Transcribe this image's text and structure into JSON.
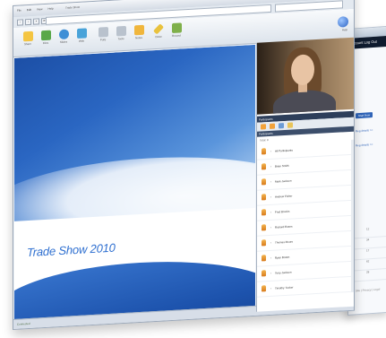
{
  "window": {
    "menu": [
      "File",
      "Edit",
      "View",
      "Help"
    ],
    "title": "Trade Show",
    "controls": [
      "–",
      "□",
      "×"
    ]
  },
  "navbar": {
    "buttons": [
      "‹",
      "›",
      "×",
      "⟳"
    ]
  },
  "toolbar": {
    "items": [
      {
        "label": "Share",
        "icon": "share-icon",
        "color": "#f4c542"
      },
      {
        "label": "Files",
        "icon": "files-icon",
        "color": "#5aa84a"
      },
      {
        "label": "Slides",
        "icon": "slides-icon",
        "color": "#3e8fd6"
      },
      {
        "label": "Web",
        "icon": "web-icon",
        "color": "#49a3d9"
      },
      {
        "label": "Polls",
        "icon": "polls-icon",
        "color": "#b9c2cd"
      },
      {
        "label": "Tools",
        "icon": "tools-icon",
        "color": "#b9c2cd"
      },
      {
        "label": "Notes",
        "icon": "notes-icon",
        "color": "#f0b63c"
      },
      {
        "label": "Draw",
        "icon": "draw-icon",
        "color": "#e9c23d"
      },
      {
        "label": "Record",
        "icon": "record-icon",
        "color": "#7fb04a"
      }
    ],
    "help_label": "Help"
  },
  "slide": {
    "title": "Trade Show 2010"
  },
  "status": {
    "text": "Connected"
  },
  "participants": {
    "header": "Participants",
    "subheader": "Participants",
    "filter": "Total: 9",
    "icons": [
      "person-icon",
      "person-icon",
      "chat-icon",
      "hand-icon"
    ],
    "list": [
      "All Participants",
      "Brian Smith",
      "Mark Jackson",
      "Andrew Fisher",
      "Fred Brooks",
      "Richard Evans",
      "Thomas Moore",
      "Ryan Brown",
      "Terry Jackson",
      "Timothy Tucker"
    ]
  },
  "back_window": {
    "nav": "Account   Log Out",
    "button": "Start Now",
    "links": [
      "Reg details >>",
      "Reg details >>"
    ],
    "rows": [
      "12",
      "34",
      "17",
      "62",
      "28"
    ],
    "footer": "Site | Privacy | Legal"
  }
}
